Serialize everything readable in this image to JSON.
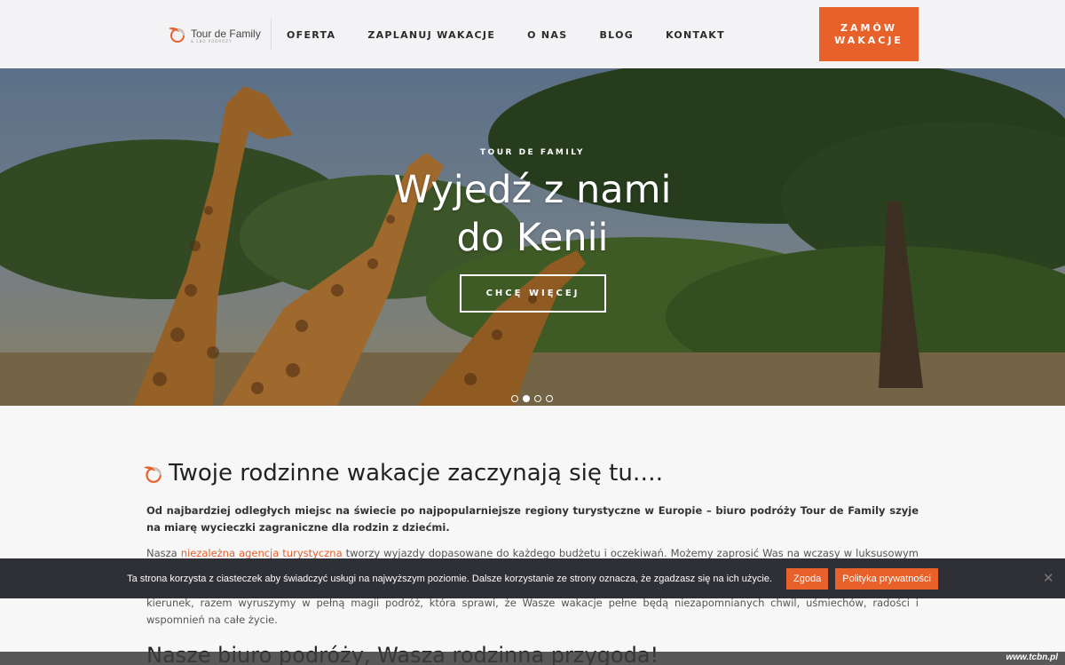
{
  "header": {
    "logo_text": "Tour de Family",
    "logo_sub": "& LBO PODRÓŻY",
    "nav": [
      "OFERTA",
      "ZAPLANUJ WAKACJE",
      "O NAS",
      "BLOG",
      "KONTAKT"
    ],
    "cta_line1": "ZAMÓW",
    "cta_line2": "WAKACJE",
    "accent_color": "#e8602a"
  },
  "hero": {
    "kicker": "TOUR DE FAMILY",
    "title_line1": "Wyjedź z nami",
    "title_line2": "do Kenii",
    "button": "CHCĘ WIĘCEJ",
    "slider_dots": 4,
    "active_dot": 2
  },
  "content": {
    "heading": "Twoje rodzinne wakacje zaczynają się tu….",
    "intro_bold": "Od najbardziej odległych miejsc na świecie po najpopularniejsze regiony turystyczne w Europie – biuro podróży Tour de Family szyje na miarę wycieczki zagraniczne dla rodzin z dziećmi.",
    "p2_before": "Nasza ",
    "p2_link": "niezależna agencja turystyczna",
    "p2_after": " tworzy wyjazdy dopasowane do każdego budżetu i oczekiwań. Możemy zaprosić Was na wczasy w luksusowym hotelu na",
    "p3": "kierunek, razem wyruszymy w pełną magii podróż, która sprawi, że Wasze wakacje pełne będą niezapomnianych chwil, uśmiechów, radości i wspomnień na całe życie.",
    "heading2": "Nasze biuro podróży, Wasza rodzinna przygoda!"
  },
  "cookie": {
    "text": "Ta strona korzysta z ciasteczek aby świadczyć usługi na najwyższym poziomie. Dalsze korzystanie ze strony oznacza, że zgadzasz się na ich użycie.",
    "accept": "Zgoda",
    "policy": "Polityka prywatności",
    "close": "✕"
  },
  "watermark": "www.tcbn.pl"
}
